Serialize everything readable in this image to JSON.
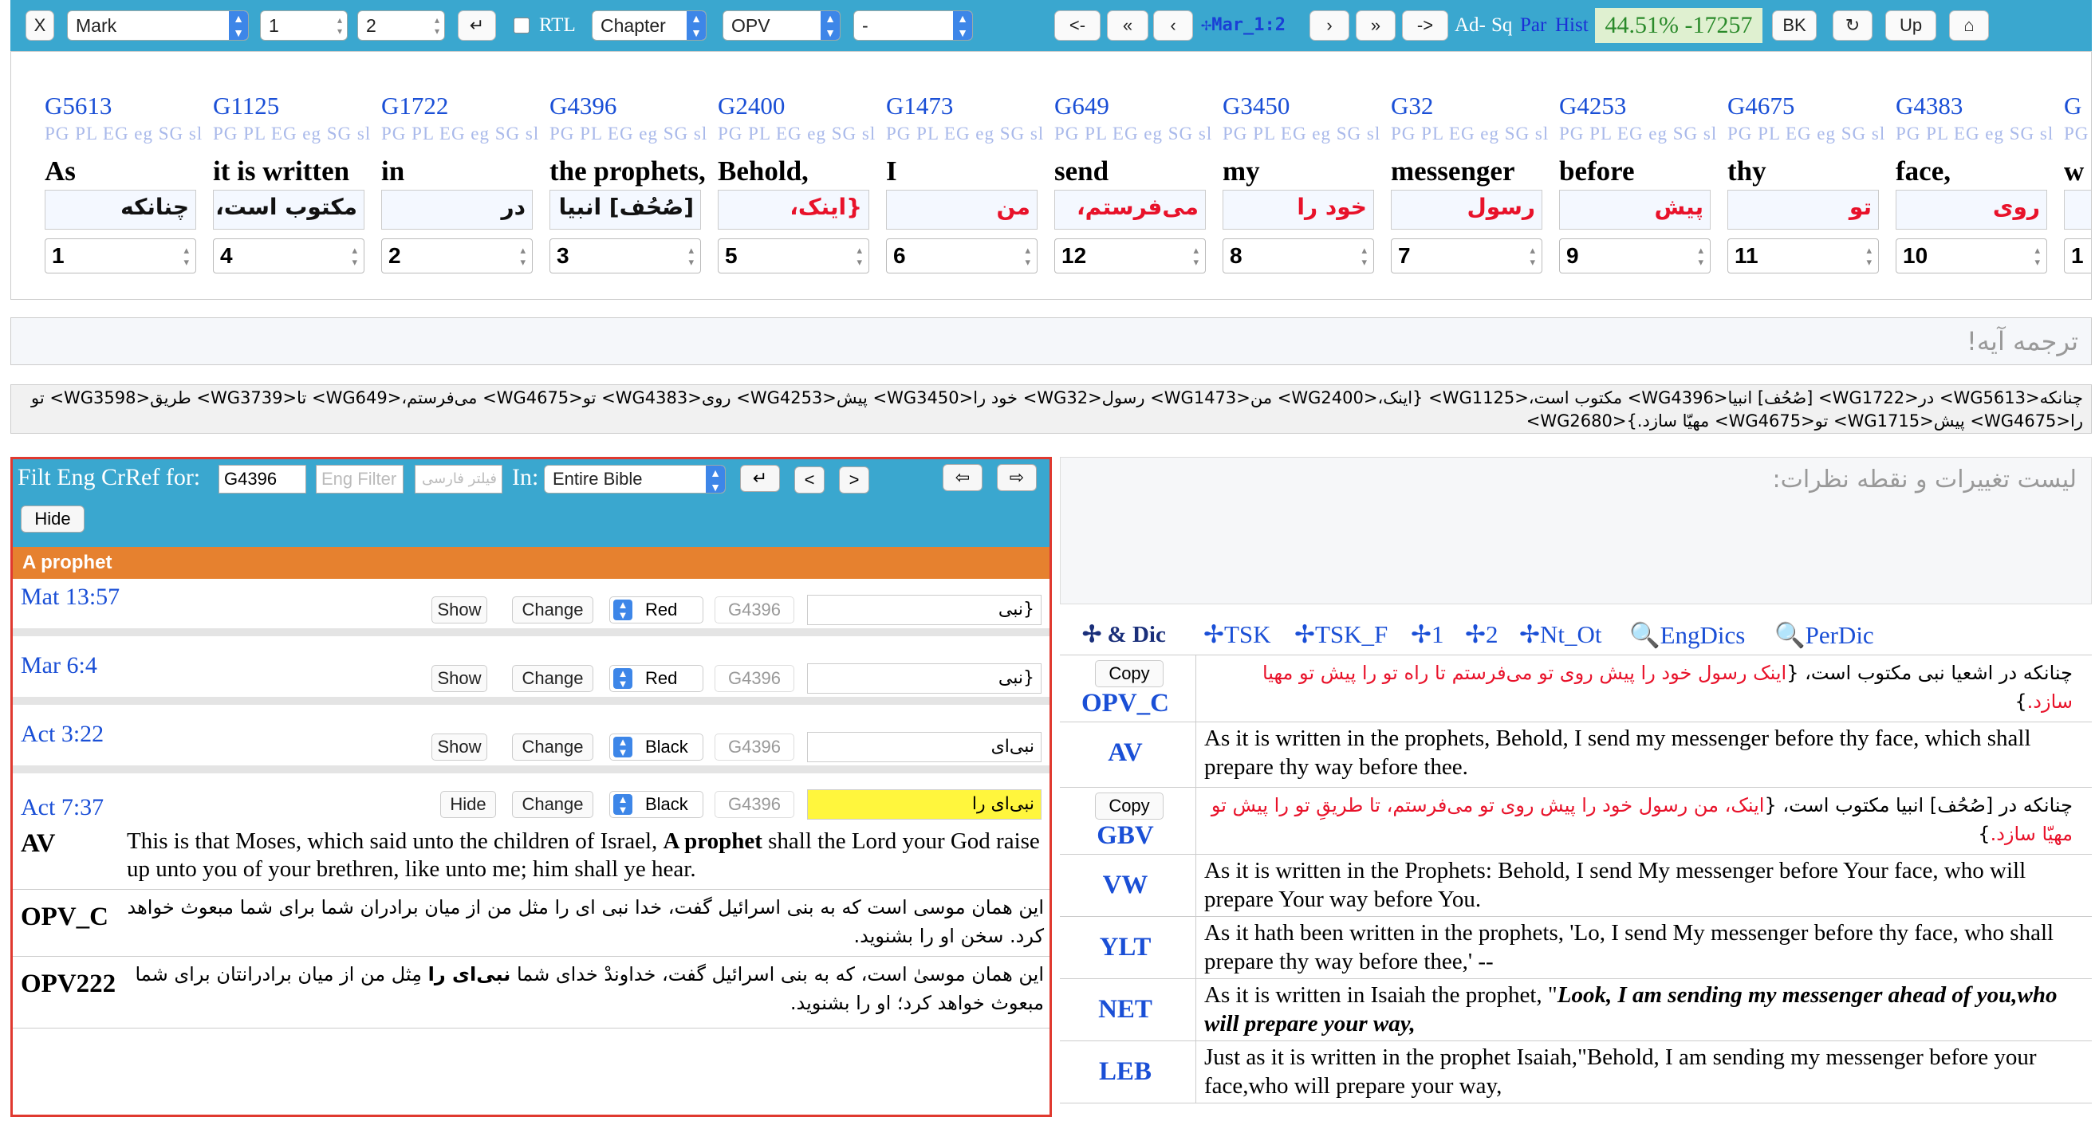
{
  "toolbar": {
    "close": "X",
    "book": "Mark",
    "chapter_num": "1",
    "verse_num": "2",
    "enter": "↵",
    "rtl_label": "RTL",
    "unit": "Chapter",
    "version": "OPV",
    "dash": "-",
    "back_arrow": "<-",
    "first": "«",
    "prev": "‹",
    "ref": "✢Mar_1:2",
    "next": "›",
    "last": "»",
    "fwd_arrow": "->",
    "ad": "Ad-",
    "sq": "Sq",
    "par": "Par",
    "hist": "Hist",
    "progress": "44.51% -17257",
    "bk": "BK",
    "refresh": "↻",
    "up": "Up",
    "home": "⌂"
  },
  "words": [
    {
      "g": "G5613",
      "eng": "As",
      "fa": "چنانکه",
      "n": "1",
      "red": false
    },
    {
      "g": "G1125",
      "eng": "it is written",
      "fa": "مکتوب است،",
      "n": "4",
      "red": false
    },
    {
      "g": "G1722",
      "eng": "in",
      "fa": "در",
      "n": "2",
      "red": false
    },
    {
      "g": "G4396",
      "eng": "the prophets,",
      "fa": "[صُحُف] انبیا",
      "n": "3",
      "red": false
    },
    {
      "g": "G2400",
      "eng": "Behold,",
      "fa": "{اینک،",
      "n": "5",
      "red": true
    },
    {
      "g": "G1473",
      "eng": "I",
      "fa": "من",
      "n": "6",
      "red": true
    },
    {
      "g": "G649",
      "eng": "send",
      "fa": "می‌فرستم،",
      "n": "12",
      "red": true
    },
    {
      "g": "G3450",
      "eng": "my",
      "fa": "خود را",
      "n": "8",
      "red": true
    },
    {
      "g": "G32",
      "eng": "messenger",
      "fa": "رسول",
      "n": "7",
      "red": true
    },
    {
      "g": "G4253",
      "eng": "before",
      "fa": "پیش",
      "n": "9",
      "red": true
    },
    {
      "g": "G4675",
      "eng": "thy",
      "fa": "تو",
      "n": "11",
      "red": true
    },
    {
      "g": "G4383",
      "eng": "face,",
      "fa": "روی",
      "n": "10",
      "red": true
    },
    {
      "g": "G",
      "eng": "w",
      "fa": "",
      "n": "1",
      "red": true
    }
  ],
  "word_tags": "PG PL EG eg SG sl",
  "translation_placeholder": "ترجمه آیه!",
  "interlinear": "چنانکه<WG5613> در<WG1722> [صُحُف] انبیا<WG4396> مکتوب است،<WG1125> {اینک،<WG2400> من<WG1473> رسول<WG32> خود را<WG3450> پیش<WG4253> روی<WG4383> تو<WG4675> می‌فرستم،<WG649> تا<WG3739> طریق<WG3598> تو را<WG4675> پیش<WG1715> تو<WG4675> مهیّا سازد.}<WG2680>",
  "xref": {
    "title": "Filt Eng CrRef for:",
    "code": "G4396",
    "eng_filter": "Eng Filter",
    "fa_filter": "فیلتر فارسی",
    "in_label": "In:",
    "scope": "Entire Bible",
    "enter": "↵",
    "prev": "<",
    "next": ">",
    "left": "⇦",
    "right": "⇨",
    "hide": "Hide",
    "heading": "A prophet",
    "rows": [
      {
        "ref": "Mat 13:57",
        "show": "Show",
        "change": "Change",
        "color": "Red",
        "g": "G4396",
        "fa": "{نبی"
      },
      {
        "ref": "Mar 6:4",
        "show": "Show",
        "change": "Change",
        "color": "Red",
        "g": "G4396",
        "fa": "{نبی"
      },
      {
        "ref": "Act 3:22",
        "show": "Show",
        "change": "Change",
        "color": "Black",
        "g": "G4396",
        "fa": "نبی‌ای"
      },
      {
        "ref": "Act 7:37",
        "show": "Hide",
        "change": "Change",
        "color": "Black",
        "g": "G4396",
        "fa": "نبی‌ای را"
      }
    ],
    "verses": [
      {
        "lab": "AV",
        "pre": "This is that Moses, which said unto the children of Israel, ",
        "bold": "A prophet",
        "post": " shall the Lord your God raise up unto you of your brethren, like unto me; him shall ye hear."
      },
      {
        "lab": "OPV_C",
        "text": "این همان موسی است که به بنی اسرائیل گفت، خدا نبی ای را مثل من از میان برادران شما برای شما مبعوث خواهد کرد. سخن او را بشنوید."
      },
      {
        "lab": "OPV222",
        "pre": "این همان موسیٰ است، که به بنی اسرائیل گفت، خداوندْ خدای شما ",
        "bold": "نبی‌ای را",
        "post": " مِثل من از میان برادرانتان برای شما مبعوث خواهد کرد؛ او را بشنوید."
      }
    ]
  },
  "notes_placeholder": "لیست تغییرات و نقطه نظرات:",
  "tabs": {
    "dic": "✢ & Dic",
    "tsk": "✢TSK",
    "tsk_f": "✢TSK_F",
    "t1": "✢1",
    "t2": "✢2",
    "nt": "✢Nt_Ot",
    "engdic": "EngDics",
    "perdic": "PerDic"
  },
  "versions": [
    {
      "lab": "OPV_C",
      "copy": "Copy",
      "pre": "چنانکه در اشعیا نبی مکتوب است، {",
      "red": "اینک رسول خود را پیش روی تو می‌فرستم تا راه تو را پیش تو مهیا سازد.",
      "post": "}"
    },
    {
      "lab": "AV",
      "text": "As it is written in the prophets, Behold, I send my messenger before thy face, which shall prepare thy way before thee."
    },
    {
      "lab": "GBV",
      "copy": "Copy",
      "pre": "چنانکه در [صُحُف] انبیا مکتوب است، {",
      "red": "اینک، من رسول خود را پیش روی تو می‌فرستم، تا طریقِ تو را پیش تو مهیّا سازد.",
      "post": "}"
    },
    {
      "lab": "VW",
      "text": "As it is written in the Prophets: Behold, I send My messenger before Your face, who will prepare Your way before You."
    },
    {
      "lab": "YLT",
      "text": "As it hath been written in the prophets, 'Lo, I send My messenger before thy face, who shall prepare thy way before thee,' --"
    },
    {
      "lab": "NET",
      "pre": "As it is written in Isaiah the prophet, \"",
      "em": "Look, I am sending my messenger ahead of you,who will prepare your way,"
    },
    {
      "lab": "LEB",
      "text": "Just as it is written in the prophet Isaiah,\"Behold, I am sending my messenger before your face,who will prepare your way,"
    }
  ]
}
